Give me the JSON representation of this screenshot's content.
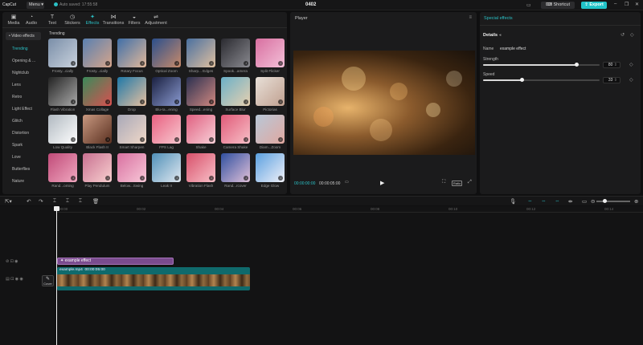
{
  "titlebar": {
    "logo": "CapCut",
    "menu_label": "Menu",
    "autosave": "Auto saved: 17:55:58",
    "project_title": "0402",
    "shortcut_label": "Shortcut",
    "export_label": "Export"
  },
  "tabs": [
    {
      "label": "Media",
      "icon": "media-icon"
    },
    {
      "label": "Audio",
      "icon": "audio-icon"
    },
    {
      "label": "Text",
      "icon": "text-icon"
    },
    {
      "label": "Stickers",
      "icon": "stickers-icon"
    },
    {
      "label": "Effects",
      "icon": "effects-icon"
    },
    {
      "label": "Transitions",
      "icon": "transitions-icon"
    },
    {
      "label": "Filters",
      "icon": "filters-icon"
    },
    {
      "label": "Adjustment",
      "icon": "adjustment-icon"
    }
  ],
  "categories": {
    "header": "• Video effects",
    "items": [
      "Trending",
      "Opening & ...",
      "Nightclub",
      "Lens",
      "Retro",
      "Light Effect",
      "Glitch",
      "Distortion",
      "Spark",
      "Love",
      "Butterflies",
      "Nature"
    ]
  },
  "grid": {
    "section": "Trending",
    "rows": [
      [
        "Frosty...cially",
        "Frosty...cially",
        "Rotary Focus",
        "Optical Zoom",
        "Sharp... Edges",
        "Spook...amera",
        "Split Flicker"
      ],
      [
        "Flash Vibration",
        "Xmas Collage",
        "Drop",
        "Blu-ra...ening",
        "Speed...ening",
        "Surface Blur",
        "Pictorias"
      ],
      [
        "Low Quality",
        "Black Flash II",
        "Smart Sharpen",
        "FPS Lag",
        "Shake",
        "Camera Shake",
        "Diam...Zoom"
      ],
      [
        "Rand...oming",
        "Play Pendulum",
        "Below...Swing",
        "Leak II",
        "Vibration Flash",
        "Rand...rcover",
        "Edge Glow"
      ]
    ]
  },
  "player": {
    "title": "Player",
    "time_current": "00:00:00:00",
    "time_total": "00:00:05:00",
    "ratio_label": "Ratio"
  },
  "inspector": {
    "title": "Special effects",
    "details_label": "Details",
    "name_label": "Name",
    "name_value": "example effect",
    "strength_label": "Strength",
    "strength_value": "80",
    "strength_level": 0.8,
    "speed_label": "Speed",
    "speed_value": "33",
    "speed_level": 0.33
  },
  "timeline": {
    "ruler_ticks": [
      "00:00",
      "00:02",
      "00:04",
      "00:06",
      "00:08",
      "00:10",
      "00:12",
      "00:14"
    ],
    "effect_clip_label": "example effect",
    "video_clip_name": "example.mp4",
    "video_clip_duration": "00:00:05:00",
    "cover_label": "Cover"
  },
  "colors": {
    "accent": "#2bc0c5",
    "effect_clip": "#7a4b8e",
    "video_clip": "#0f6a6c"
  }
}
